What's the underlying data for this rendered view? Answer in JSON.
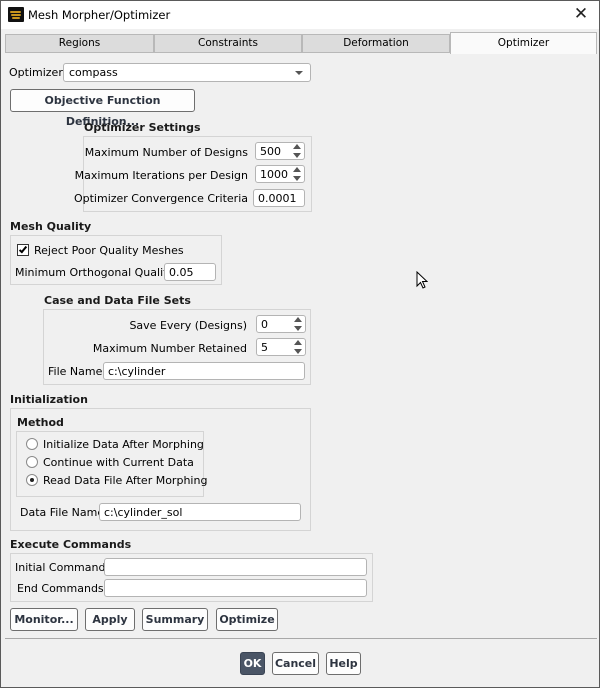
{
  "window": {
    "title": "Mesh Morpher/Optimizer",
    "close_glyph": "✕"
  },
  "tabs": [
    {
      "label": "Regions",
      "active": false
    },
    {
      "label": "Constraints",
      "active": false
    },
    {
      "label": "Deformation",
      "active": false
    },
    {
      "label": "Optimizer",
      "active": true
    }
  ],
  "optimizer": {
    "label": "Optimizer",
    "selected": "compass",
    "objective_button": "Objective Function Definition..."
  },
  "optimizer_settings": {
    "header": "Optimizer Settings",
    "max_designs_label": "Maximum Number of Designs",
    "max_designs_value": "500",
    "max_iterations_label": "Maximum Iterations per Design",
    "max_iterations_value": "1000",
    "convergence_label": "Optimizer Convergence Criteria",
    "convergence_value": "0.0001"
  },
  "mesh_quality": {
    "header": "Mesh Quality",
    "reject_label": "Reject Poor Quality Meshes",
    "reject_checked": true,
    "min_orth_label": "Minimum Orthogonal Quality",
    "min_orth_value": "0.05"
  },
  "case_data": {
    "header": "Case and Data File Sets",
    "save_every_label": "Save Every (Designs)",
    "save_every_value": "0",
    "max_retained_label": "Maximum Number Retained",
    "max_retained_value": "5",
    "file_name_label": "File Name",
    "file_name_value": "c:\\cylinder"
  },
  "initialization": {
    "header": "Initialization",
    "method_header": "Method",
    "options": [
      {
        "label": "Initialize Data After Morphing",
        "checked": false
      },
      {
        "label": "Continue with Current Data",
        "checked": false
      },
      {
        "label": "Read Data File After Morphing",
        "checked": true
      }
    ],
    "data_file_label": "Data File Name",
    "data_file_value": "c:\\cylinder_sol"
  },
  "execute": {
    "header": "Execute Commands",
    "initial_label": "Initial Commands",
    "initial_value": "",
    "end_label": "End Commands",
    "end_value": ""
  },
  "actions": {
    "monitor": "Monitor...",
    "apply": "Apply",
    "summary": "Summary",
    "optimize": "Optimize"
  },
  "footer": {
    "ok": "OK",
    "cancel": "Cancel",
    "help": "Help"
  }
}
